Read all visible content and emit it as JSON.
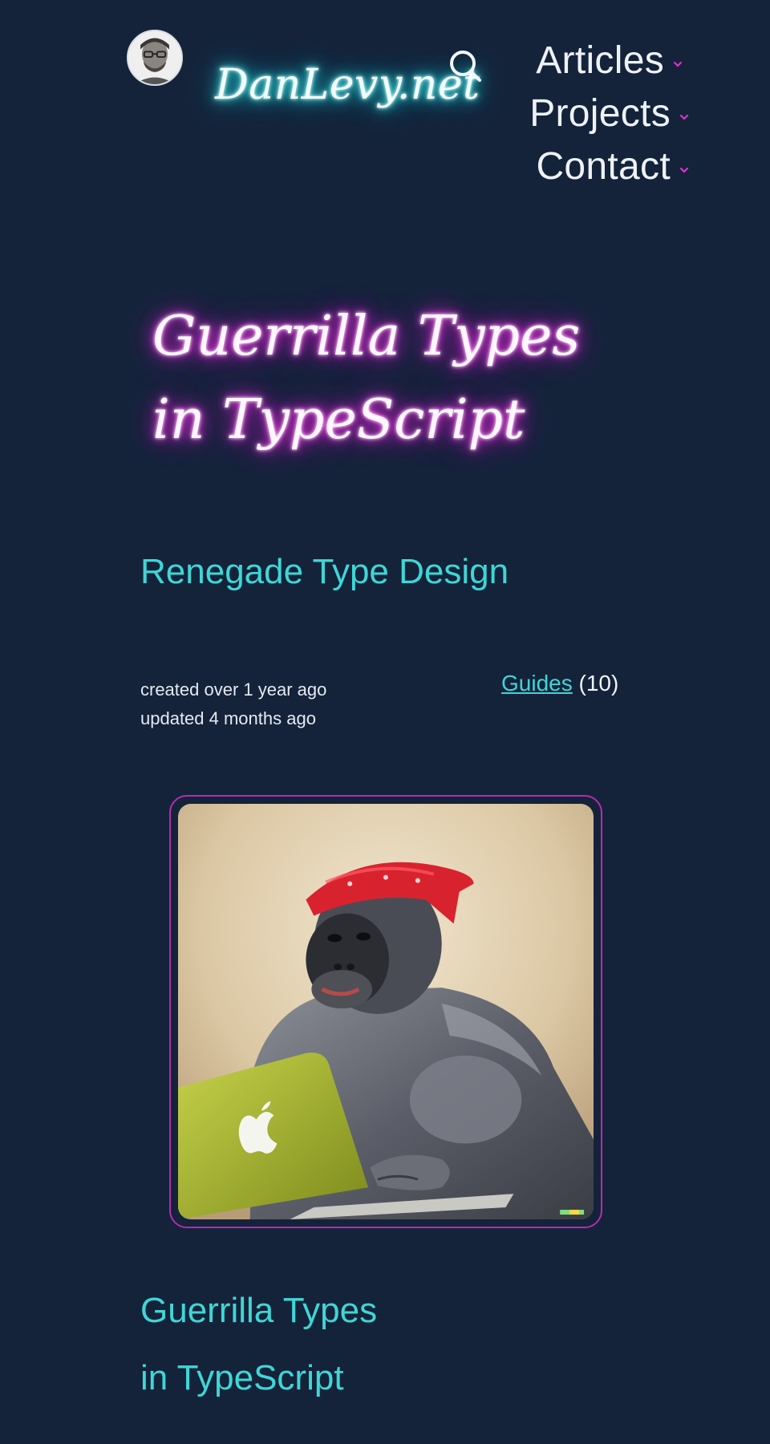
{
  "header": {
    "logo": "DanLevy.net",
    "nav": [
      {
        "label": "Articles"
      },
      {
        "label": "Projects"
      },
      {
        "label": "Contact"
      }
    ]
  },
  "article": {
    "title_line1": "Guerrilla Types",
    "title_line2": "in TypeScript",
    "subtitle": "Renegade Type Design",
    "created": "created over 1 year ago",
    "updated": "updated 4 months ago",
    "category_label": "Guides",
    "category_count": "(10)"
  },
  "colors": {
    "background": "#14233a",
    "accent_cyan": "#3fd6d6",
    "accent_magenta": "#e020d6",
    "image_border": "#b52bb5"
  },
  "icons": {
    "search": "search-icon",
    "dropdown": "chevron-down-icon",
    "avatar": "avatar"
  }
}
